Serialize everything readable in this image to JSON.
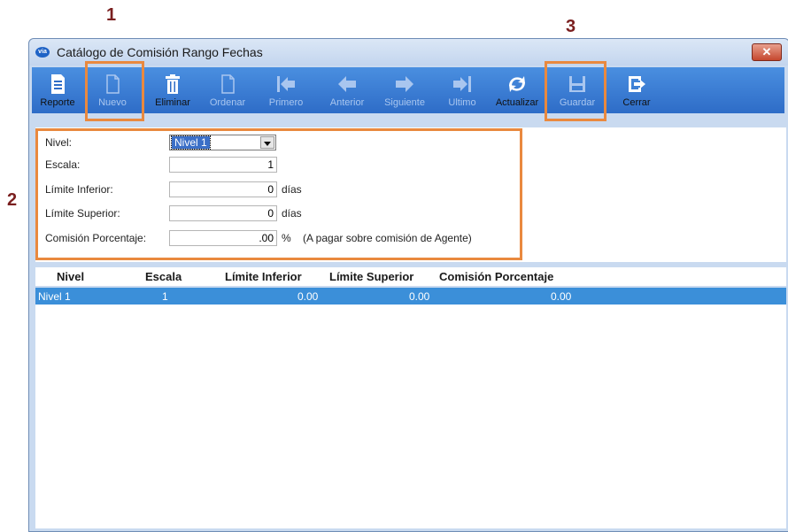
{
  "callouts": [
    "1",
    "2",
    "3"
  ],
  "window": {
    "title": "Catálogo de Comisión Rango Fechas",
    "app_icon_text": "via",
    "close_symbol": "✕"
  },
  "toolbar": {
    "reporte": "Reporte",
    "nuevo": "Nuevo",
    "eliminar": "Eliminar",
    "ordenar": "Ordenar",
    "primero": "Primero",
    "anterior": "Anterior",
    "siguiente": "Siguiente",
    "ultimo": "Ultimo",
    "actualizar": "Actualizar",
    "guardar": "Guardar",
    "cerrar": "Cerrar"
  },
  "form": {
    "nivel_label": "Nivel:",
    "nivel_value": "Nivel 1",
    "escala_label": "Escala:",
    "escala_value": "1",
    "limite_inferior_label": "Límite Inferior:",
    "limite_inferior_value": "0",
    "limite_superior_label": "Límite Superior:",
    "limite_superior_value": "0",
    "comision_label": "Comisión Porcentaje:",
    "comision_value": ".00",
    "unit_dias": "días",
    "unit_percent": "%",
    "comision_note": "(A pagar sobre comisión de Agente)"
  },
  "grid": {
    "columns": [
      "Nivel",
      "Escala",
      "Límite Inferior",
      "Límite Superior",
      "Comisión Porcentaje"
    ],
    "rows": [
      {
        "nivel": "Nivel 1",
        "escala": "1",
        "limite_inferior": "0.00",
        "limite_superior": "0.00",
        "comision": "0.00"
      }
    ]
  },
  "colors": {
    "toolbar": "#2e6cc7",
    "highlight": "#e9893f",
    "selected_row": "#3b8fd9",
    "window_bg": "#c9daf0"
  },
  "icons": [
    "report-icon",
    "new-doc-icon",
    "trash-icon",
    "sort-doc-icon",
    "first-arrow-icon",
    "prev-arrow-icon",
    "next-arrow-icon",
    "last-arrow-icon",
    "refresh-icon",
    "save-icon",
    "exit-icon",
    "dropdown-arrow-icon"
  ]
}
